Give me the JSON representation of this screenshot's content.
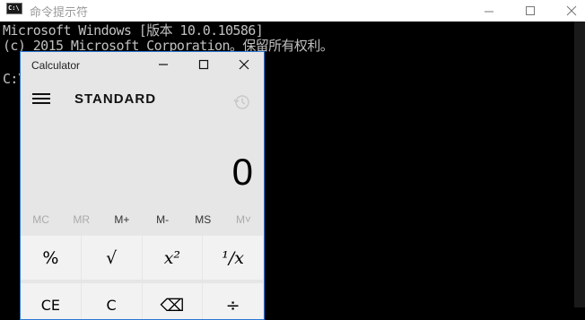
{
  "console": {
    "title": "命令提示符",
    "icon": "C:\\",
    "lines": [
      "Microsoft Windows [版本 10.0.10586]",
      "(c) 2015 Microsoft Corporation。保留所有权利。",
      "",
      "C:\\"
    ]
  },
  "calculator": {
    "title": "Calculator",
    "mode": "STANDARD",
    "display": "0",
    "memory": [
      "MC",
      "MR",
      "M+",
      "M-",
      "MS",
      "M˅"
    ],
    "row1": [
      "%",
      "√",
      "x²",
      "¹/x"
    ],
    "row2": [
      "CE",
      "C",
      "⌫",
      "÷"
    ],
    "accent": "#2b78d4"
  }
}
